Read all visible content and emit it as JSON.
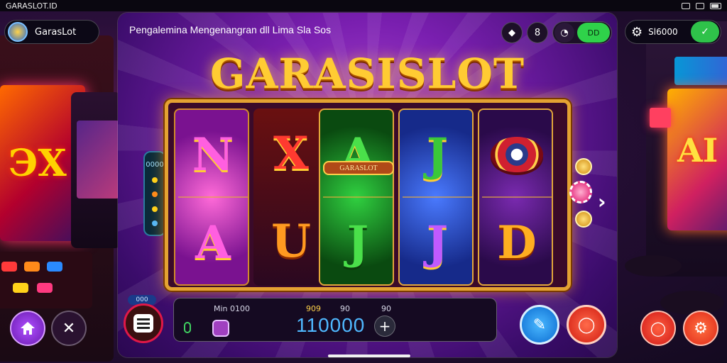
{
  "status_bar": {
    "app_name": "GARASLOT.ID"
  },
  "brand": {
    "name": "GarasLot"
  },
  "header": {
    "marquee": "Pengalemina Mengenangran dll Lima Sla Sos"
  },
  "top_controls": {
    "toggle_label": "DD"
  },
  "logo": {
    "text": "GARASISLOT"
  },
  "reels": [
    {
      "top": "N",
      "bottom": "A"
    },
    {
      "top": "X",
      "bottom": "U"
    },
    {
      "top": "A",
      "bottom": "J",
      "banner": "GARASLOT"
    },
    {
      "top": "J",
      "bottom": "J"
    },
    {
      "top": "",
      "bottom": "D"
    }
  ],
  "side_meter": {
    "label": "0000"
  },
  "bet_panel": {
    "min_label": "Min 0100",
    "label_a": "909",
    "label_b": "90",
    "label_c": "90",
    "amount": "110000",
    "plus": "+"
  },
  "menu_tag": "000",
  "settings": {
    "label": "Sl6000"
  },
  "colors": {
    "panel": "#7a1fb0",
    "gold": "#ffcc33",
    "accent_green": "#2fd24a",
    "accent_red": "#e01848",
    "amount_blue": "#4fb8ff"
  }
}
